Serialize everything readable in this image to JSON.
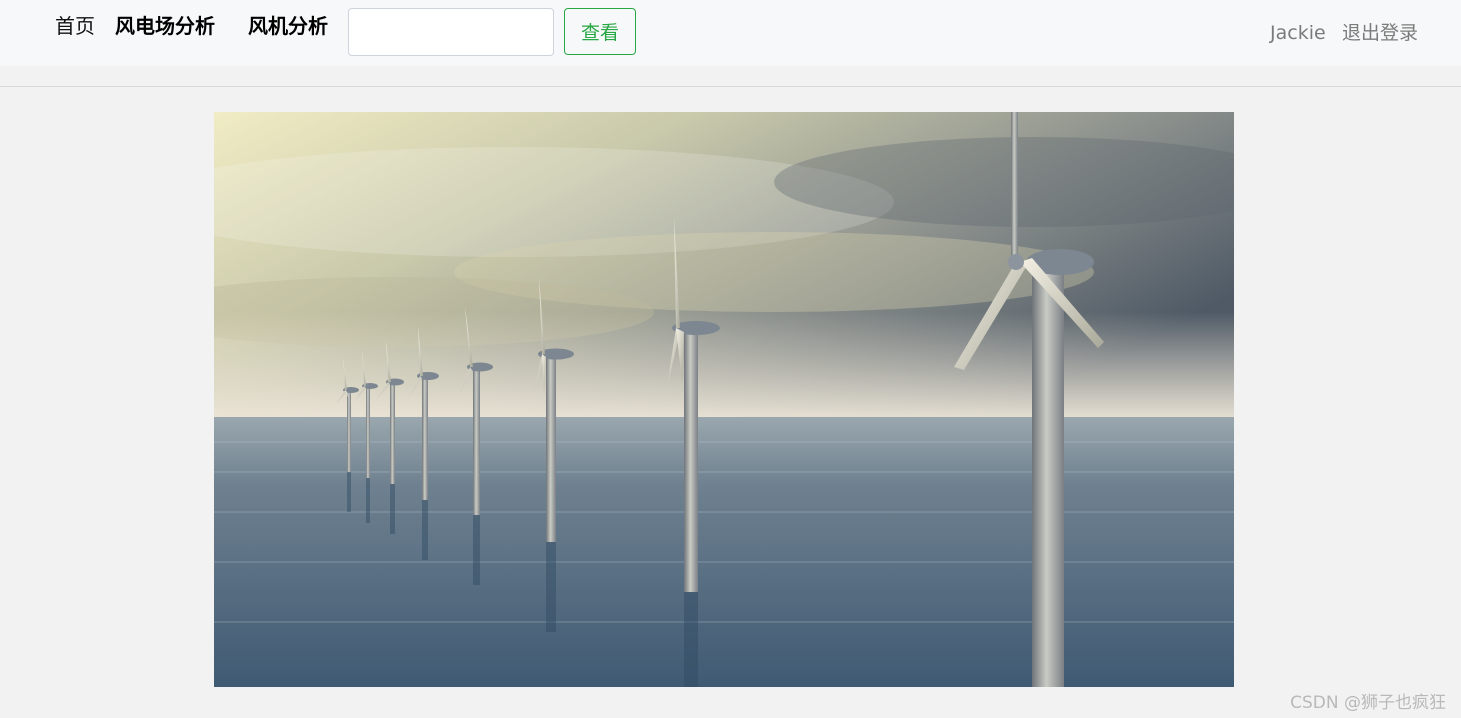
{
  "navbar": {
    "home_label": "首页",
    "wind_farm_label": "风电场分析",
    "turbine_label": "风机分析",
    "search": {
      "value": "",
      "placeholder": ""
    },
    "view_button_label": "查看",
    "username": "Jackie",
    "logout_label": "退出登录"
  },
  "hero": {
    "description_icon": "offshore-wind-turbines-image"
  },
  "watermark": "CSDN @狮子也疯狂",
  "colors": {
    "accent_green": "#28a745",
    "page_background": "#f2f2f2",
    "navbar_background": "#f7f8f9"
  }
}
